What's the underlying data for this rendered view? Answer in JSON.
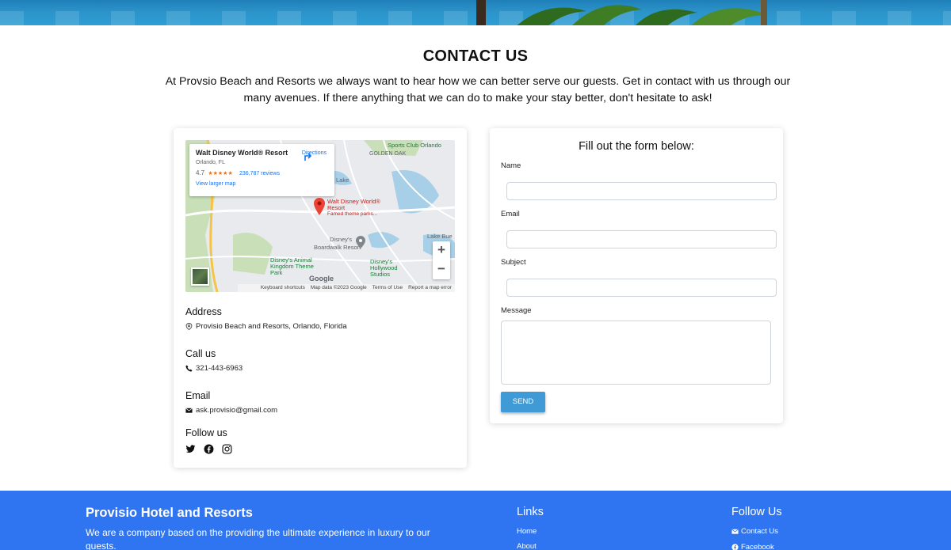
{
  "contact": {
    "title": "CONTACT US",
    "intro": "At Provsio Beach and Resorts we always want to hear how we can better serve our guests. Get in contact with us through our many avenues. If there anything that we can do to make your stay better, don't hesitate to ask!"
  },
  "map": {
    "place_name": "Walt Disney World® Resort",
    "place_location": "Orlando, FL",
    "rating": "4.7",
    "stars": "★★★★★",
    "reviews": "236,787 reviews",
    "view_larger": "View larger map",
    "directions": "Directions",
    "zoom_in": "+",
    "zoom_out": "−",
    "google": "Google",
    "footer": [
      "Keyboard shortcuts",
      "Map data ©2023 Google",
      "Terms of Use",
      "Report a map error"
    ],
    "labels": {
      "sports_club": "Sports Club Orlando",
      "golden_oak": "GOLDEN OAK",
      "lake": "Lake",
      "pin_title": "Walt Disney World® Resort",
      "pin_sub": "Famed theme parks...",
      "disneys": "Disney's",
      "boardwalk": "Boardwalk Resort",
      "animal_kingdom": "Disney's Animal Kingdom Theme Park",
      "hollywood": "Disney's Hollywood Studios",
      "lake_buena": "Lake Bue"
    }
  },
  "info": {
    "address_heading": "Address",
    "address": "Provisio Beach and Resorts, Orlando, Florida",
    "call_heading": "Call us",
    "phone": "321-443-6963",
    "email_heading": "Email",
    "email": "ask.provisio@gmail.com",
    "follow_heading": "Follow us",
    "social_icons": [
      "twitter-icon",
      "facebook-icon",
      "instagram-icon"
    ]
  },
  "form": {
    "title": "Fill out the form below:",
    "name_label": "Name",
    "email_label": "Email",
    "subject_label": "Subject",
    "message_label": "Message",
    "send_label": "SEND"
  },
  "footer": {
    "brand": "Provisio Hotel and Resorts",
    "description": "We are a company based on the providing the ultimate experience in luxury to our guests.",
    "links_heading": "Links",
    "links": [
      "Home",
      "About"
    ],
    "follow_heading": "Follow Us",
    "follow_items": [
      "Contact Us",
      "Facebook"
    ]
  },
  "colors": {
    "footer_bg": "#2f74f0",
    "send_button": "#3f9ad6",
    "map_pin": "#ea4335",
    "link": "#1a73e8"
  }
}
